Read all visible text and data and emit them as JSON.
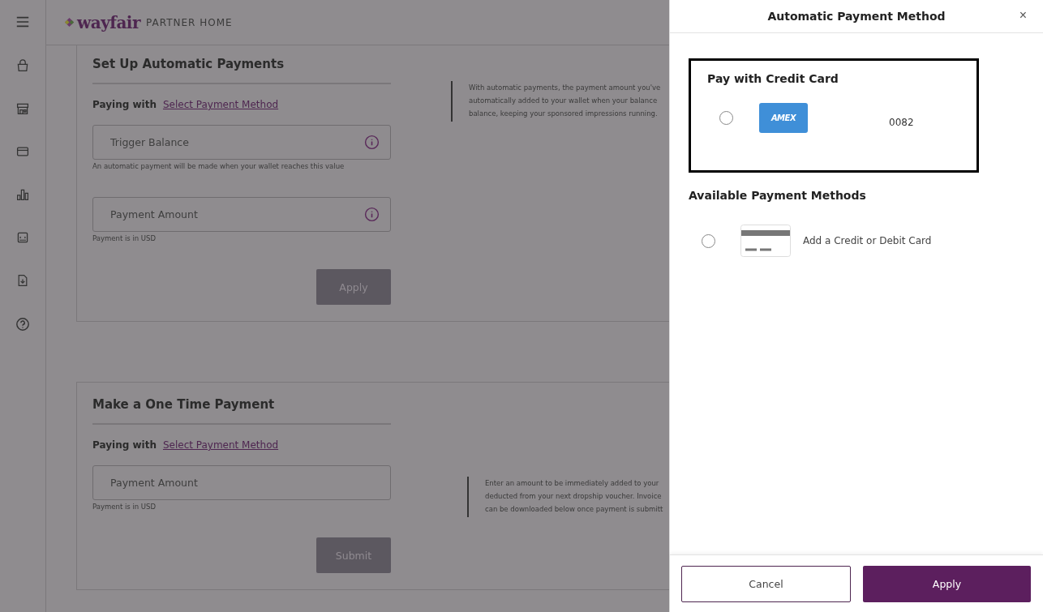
{
  "header": {
    "logo": "wayfair",
    "product": "PARTNER HOME"
  },
  "sidebar": {
    "items": [
      {
        "kind": "menu"
      },
      {
        "kind": "bag"
      },
      {
        "kind": "store"
      },
      {
        "kind": "card"
      },
      {
        "kind": "chart"
      },
      {
        "kind": "badge"
      },
      {
        "kind": "file"
      },
      {
        "kind": "help"
      }
    ]
  },
  "sections": [
    {
      "title": "Set Up Automatic Payments",
      "paying_label": "Paying with",
      "paying_link": "Select Payment Method",
      "fields": [
        {
          "placeholder": "Trigger Balance",
          "info": true,
          "hint": "An automatic payment will be made when your wallet reaches this value"
        },
        {
          "placeholder": "Payment Amount",
          "info": true,
          "hint": "Payment is in USD"
        }
      ],
      "button": "Apply",
      "button_disabled": true,
      "note": [
        "With automatic payments, the payment amount you've",
        "automatically added to your wallet when your balance",
        "balance, keeping your sponsored impressions running."
      ]
    },
    {
      "title": "Make a One Time Payment",
      "paying_label": "Paying with",
      "paying_link": "Select Payment Method",
      "fields": [
        {
          "placeholder": "Payment Amount",
          "info": false,
          "hint": "Payment is in USD"
        }
      ],
      "button": "Submit",
      "button_disabled": true,
      "note": [
        "Enter an amount to be immediately added to your",
        "deducted from your next dropship voucher. Invoice",
        "can be downloaded below once payment is submitt"
      ]
    }
  ],
  "drawer": {
    "title": "Automatic Payment Method",
    "close": "×",
    "saved_heading": "Pay with Credit Card",
    "saved": [
      {
        "kind": "amex",
        "brand": "AMEX",
        "last4": "0082",
        "selected": false
      }
    ],
    "available_heading": "Available Payment Methods",
    "available": [
      {
        "kind": "generic",
        "label": "Add a Credit or Debit Card",
        "selected": false
      }
    ],
    "cancel": "Cancel",
    "apply": "Apply"
  }
}
